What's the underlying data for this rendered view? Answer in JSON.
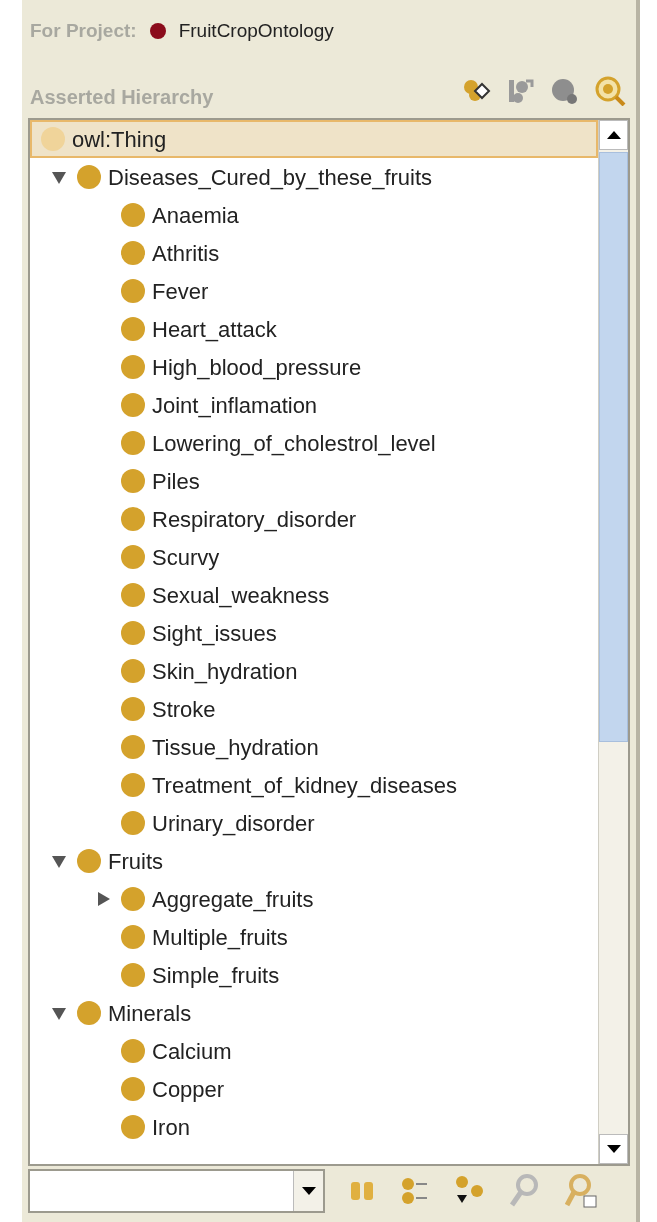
{
  "project": {
    "label": "For Project:",
    "name": "FruitCropOntology"
  },
  "hierarchy": {
    "title": "Asserted Hierarchy"
  },
  "tree": [
    {
      "label": "owl:Thing",
      "selected": true,
      "children": [
        {
          "label": "Diseases_Cured_by_these_fruits",
          "expanded": true,
          "selected": false,
          "children": [
            {
              "label": "Anaemia",
              "selected": false
            },
            {
              "label": "Athritis",
              "selected": false
            },
            {
              "label": "Fever",
              "selected": false
            },
            {
              "label": "Heart_attack",
              "selected": false
            },
            {
              "label": "High_blood_pressure",
              "selected": false
            },
            {
              "label": "Joint_inflamation",
              "selected": false
            },
            {
              "label": "Lowering_of_cholestrol_level",
              "selected": false
            },
            {
              "label": "Piles",
              "selected": false
            },
            {
              "label": "Respiratory_disorder",
              "selected": false
            },
            {
              "label": "Scurvy",
              "selected": false
            },
            {
              "label": "Sexual_weakness",
              "selected": false
            },
            {
              "label": "Sight_issues",
              "selected": false
            },
            {
              "label": "Skin_hydration",
              "selected": false
            },
            {
              "label": "Stroke",
              "selected": false
            },
            {
              "label": "Tissue_hydration",
              "selected": false
            },
            {
              "label": "Treatment_of_kidney_diseases",
              "selected": false
            },
            {
              "label": "Urinary_disorder",
              "selected": false
            }
          ]
        },
        {
          "label": "Fruits",
          "expanded": true,
          "selected": false,
          "children": [
            {
              "label": "Aggregate_fruits",
              "expanded": false,
              "selected": false
            },
            {
              "label": "Multiple_fruits",
              "selected": false
            },
            {
              "label": "Simple_fruits",
              "selected": false
            }
          ]
        },
        {
          "label": "Minerals",
          "expanded": true,
          "selected": false,
          "children": [
            {
              "label": "Calcium",
              "selected": false
            },
            {
              "label": "Copper",
              "selected": false
            },
            {
              "label": "Iron",
              "selected": false
            }
          ]
        }
      ]
    }
  ]
}
